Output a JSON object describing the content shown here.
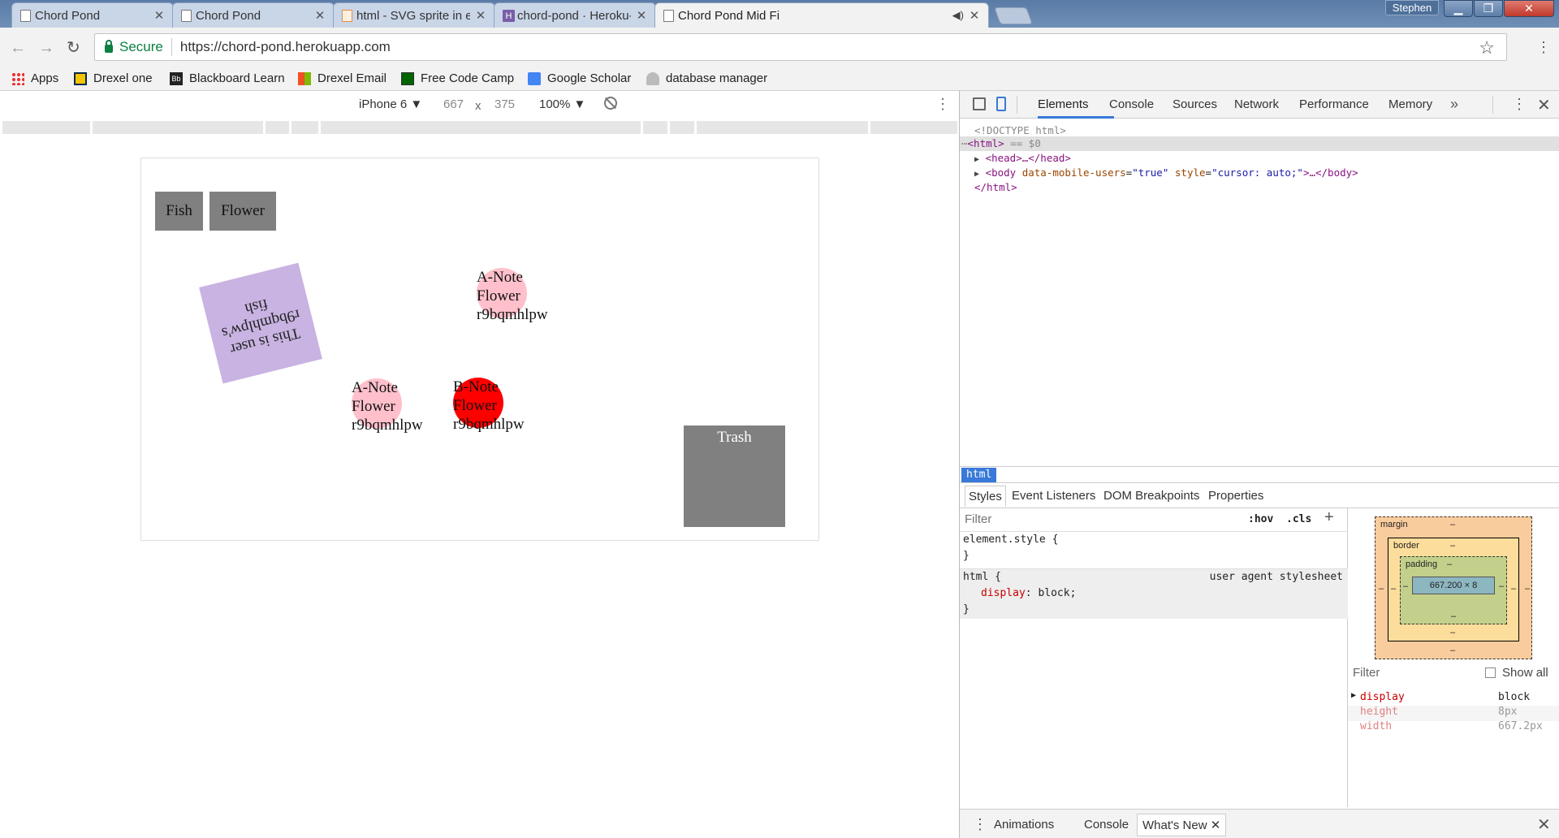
{
  "tabs": [
    {
      "title": "Chord Pond",
      "favicon": "page-icon"
    },
    {
      "title": "Chord Pond",
      "favicon": "page-icon"
    },
    {
      "title": "html - SVG sprite in exter",
      "favicon": "stackoverflow-icon"
    },
    {
      "title": "chord-pond · Heroku-git",
      "favicon": "heroku-icon"
    },
    {
      "title": "Chord Pond Mid Fi",
      "favicon": "page-icon",
      "active": true
    }
  ],
  "profile_name": "Stephen",
  "omnibox": {
    "secure_label": "Secure",
    "url": "https://chord-pond.herokuapp.com"
  },
  "bookmarks": [
    {
      "label": "Apps",
      "icon": "apps-grid-icon"
    },
    {
      "label": "Drexel one",
      "icon": "drexel-icon"
    },
    {
      "label": "Blackboard Learn",
      "icon": "blackboard-icon"
    },
    {
      "label": "Drexel Email",
      "icon": "microsoft-icon"
    },
    {
      "label": "Free Code Camp",
      "icon": "freecodecamp-icon"
    },
    {
      "label": "Google Scholar",
      "icon": "scholar-icon"
    },
    {
      "label": "database manager",
      "icon": "phpmyadmin-icon"
    }
  ],
  "device_toolbar": {
    "device": "iPhone 6",
    "width": "667",
    "times": "x",
    "height": "375",
    "zoom": "100%"
  },
  "page": {
    "fish_button": "Fish",
    "flower_button": "Flower",
    "fish_card_text": "This is user r9bqmhlpw's fish",
    "notes": [
      {
        "line1": "A-Note",
        "line2": "Flower",
        "line3": "r9bqmhlpw",
        "color": "#ffc0cb"
      },
      {
        "line1": "A-Note",
        "line2": "Flower",
        "line3": "r9bqmhlpw",
        "color": "#ffc0cb"
      },
      {
        "line1": "B-Note",
        "line2": "Flower",
        "line3": "r9bqmhlpw",
        "color": "#ff0000"
      }
    ],
    "trash_label": "Trash"
  },
  "devtools": {
    "tabs": [
      "Elements",
      "Console",
      "Sources",
      "Network",
      "Performance",
      "Memory"
    ],
    "more": "»",
    "dom": {
      "doctype": "<!DOCTYPE html>",
      "html_open": "<html>",
      "html_marker": "== $0",
      "head": "<head>…</head>",
      "body_tag": "<body",
      "body_attr1_name": "data-mobile-users",
      "body_attr1_val": "\"true\"",
      "body_attr2_name": "style",
      "body_attr2_val": "\"cursor: auto;\"",
      "body_close": ">…</body>",
      "html_close": "</html>"
    },
    "breadcrumb": "html",
    "styles_tabs": [
      "Styles",
      "Event Listeners",
      "DOM Breakpoints",
      "Properties"
    ],
    "filter_placeholder": "Filter",
    "hov": ":hov",
    "cls": ".cls",
    "rules": {
      "element_style_open": "element.style {",
      "element_style_close": "}",
      "html_selector": "html {",
      "html_source": "user agent stylesheet",
      "html_prop": "display",
      "html_val": "block;",
      "html_close": "}"
    },
    "box_model": {
      "margin": "margin",
      "border": "border",
      "padding": "padding",
      "content": "667.200 × 8",
      "dash": "–"
    },
    "computed": {
      "filter": "Filter",
      "show_all": "Show all",
      "rows": [
        {
          "name": "display",
          "value": "block"
        },
        {
          "name": "height",
          "value": "8px"
        },
        {
          "name": "width",
          "value": "667.2px"
        }
      ]
    },
    "drawer_tabs": [
      "Animations",
      "Console",
      "What's New"
    ]
  }
}
